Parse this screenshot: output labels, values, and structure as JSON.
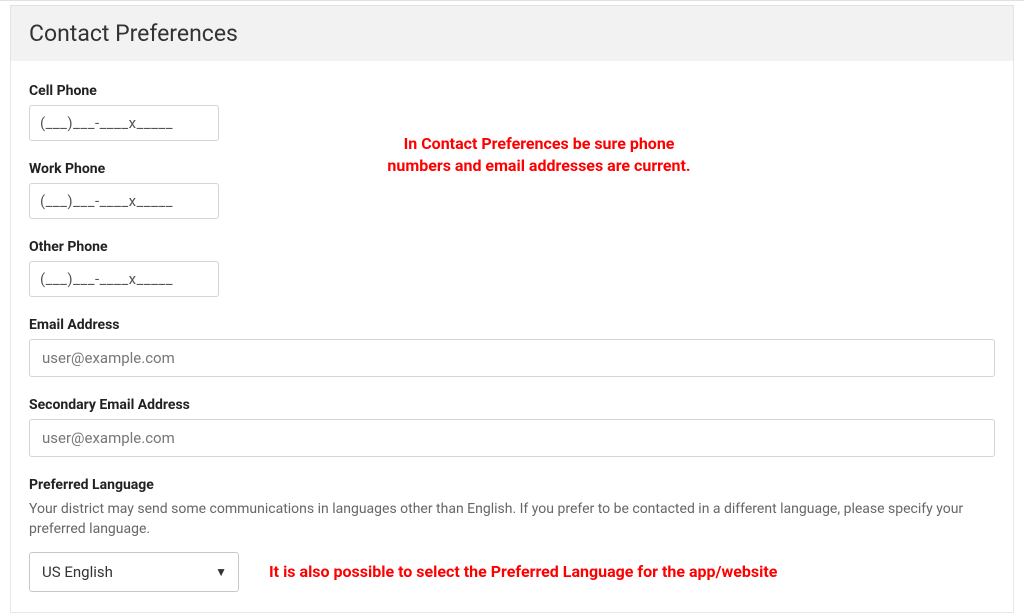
{
  "header": {
    "title": "Contact Preferences"
  },
  "fields": {
    "cell_phone": {
      "label": "Cell Phone",
      "value": "(___)___-____x_____"
    },
    "work_phone": {
      "label": "Work Phone",
      "value": "(___)___-____x_____"
    },
    "other_phone": {
      "label": "Other Phone",
      "value": "(___)___-____x_____"
    },
    "email": {
      "label": "Email Address",
      "placeholder": "user@example.com"
    },
    "secondary_email": {
      "label": "Secondary Email Address",
      "placeholder": "user@example.com"
    },
    "preferred_language": {
      "label": "Preferred Language",
      "help": "Your district may send some communications in languages other than English. If you prefer to be contacted in a different language, please specify your preferred language.",
      "selected": "US English"
    }
  },
  "annotations": {
    "phone_email_note": "In Contact Preferences be sure phone numbers and email addresses are current.",
    "language_note": "It is also possible to select the Preferred Language for the app/website"
  }
}
